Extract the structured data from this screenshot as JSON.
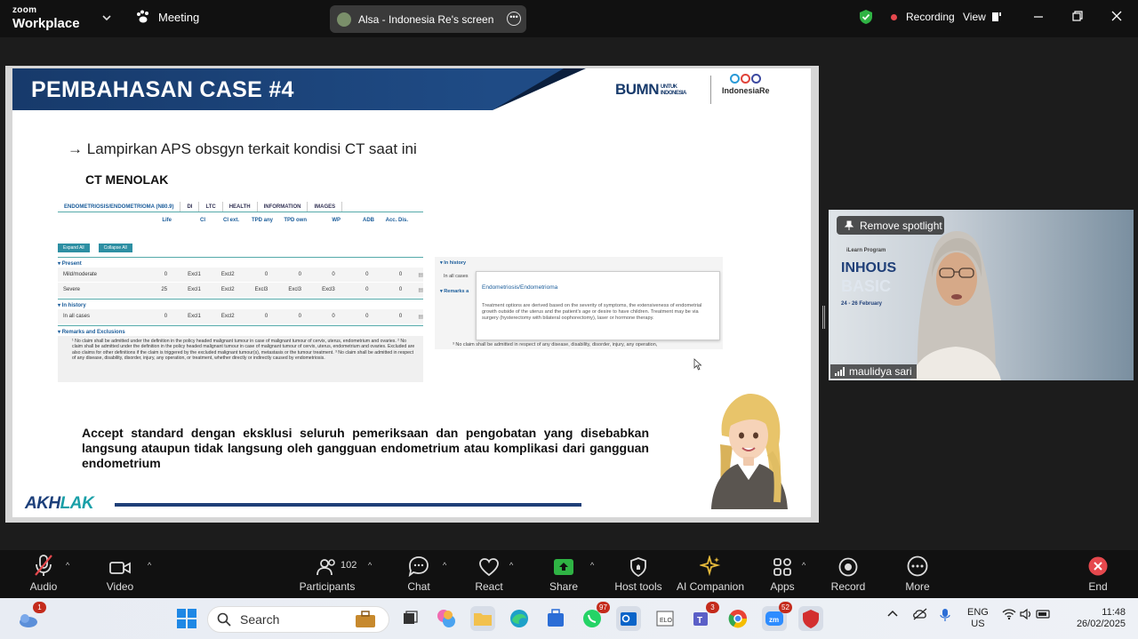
{
  "topbar": {
    "brand_line1": "zoom",
    "brand_line2": "Workplace",
    "meeting_label": "Meeting",
    "share_label": "Alsa - Indonesia Re's screen",
    "recording_label": "Recording",
    "view_label": "View"
  },
  "slide": {
    "title": "PEMBAHASAN CASE #4",
    "logo_bumn": "BUMN",
    "logo_bumn_sub": "UNTUK INDONESIA",
    "logo_ire": "IndonesiaRe",
    "bullet_arrow": "→",
    "bullet": "Lampirkan APS obsgyn terkait kondisi CT saat ini",
    "subhead": "CT MENOLAK",
    "policy_table": {
      "tabs": [
        "ENDOMETRIOSIS/ENDOMETRIOMA (N80.9)",
        "DI",
        "LTC",
        "HEALTH",
        "INFORMATION",
        "IMAGES"
      ],
      "columns": [
        "Life",
        "CI",
        "CI ext.",
        "TPD any",
        "TPD own",
        "WP",
        "ADB",
        "Acc. Dis."
      ],
      "buttons": [
        "Expand All",
        "Collapse All"
      ],
      "section_present": "Present",
      "rows_present": [
        {
          "label": "Mild/moderate",
          "cells": [
            "0",
            "Excl1",
            "Excl2",
            "0",
            "0",
            "0",
            "0",
            "0"
          ]
        },
        {
          "label": "Severe",
          "cells": [
            "25",
            "Excl1",
            "Excl2",
            "Excl3",
            "Excl3",
            "Excl3",
            "0",
            "0"
          ]
        }
      ],
      "section_history": "In history",
      "rows_history": [
        {
          "label": "In all cases",
          "cells": [
            "0",
            "Excl1",
            "Excl2",
            "0",
            "0",
            "0",
            "0",
            "0"
          ]
        }
      ],
      "section_remarks": "Remarks and Exclusions",
      "notes": "¹ No claim shall be admitted under the definition in the policy headed malignant tumour in case of malignant tumour of cervix, uterus, endometrium and ovaries. ² No claim shall be admitted under the definition in the policy headed malignant tumour in case of malignant tumour of cervix, uterus, endometrium and ovaries. Excluded are also claims for other definitions if the claim is triggered by the excluded malignant tumour(s), metastasis or the tumour treatment. ³ No claim shall be admitted in respect of any disease, disability, disorder, injury, any operation, or treatment, whether directly or indirectly caused by endometriosis."
    },
    "panel": {
      "history": "In history",
      "in_all_cases": "In all cases",
      "remarks": "Remarks a",
      "notes_fragment": "³ No claim shall be admitted in respect of any disease, disability, disorder, injury, any operation,"
    },
    "tooltip": {
      "title": "Endometriosis/Endometrioma",
      "body": "Treatment options are derived based on the severity of symptoms, the extensiveness of endometrial growth outside of the uterus and the patient's age or desire to have children. Treatment may be via surgery (hysterectomy with bilateral oophorectomy), laser or hormone therapy."
    },
    "accept_text": "Accept standard dengan eksklusi seluruh pemeriksaan dan pengobatan yang disebabkan langsung ataupun tidak langsung oleh gangguan endometrium atau komplikasi dari gangguan endometrium",
    "footer_logo_a": "AKH",
    "footer_logo_b": "LAK"
  },
  "video": {
    "remove_spotlight": "Remove spotlight",
    "participant_name": "maulidya sari",
    "banner_small": "iLearn Program",
    "banner_line1": "INHOUS",
    "banner_line2": "BASIC",
    "banner_dates": "24 - 26 February"
  },
  "toolbar": {
    "audio": "Audio",
    "video": "Video",
    "participants": "Participants",
    "participants_count": "102",
    "chat": "Chat",
    "react": "React",
    "share": "Share",
    "host_tools": "Host tools",
    "ai_companion": "AI Companion",
    "apps": "Apps",
    "record": "Record",
    "more": "More",
    "end": "End"
  },
  "taskbar": {
    "search_placeholder": "Search",
    "weather_badge": "1",
    "whatsapp_badge": "97",
    "teams_badge": "3",
    "zoom_badge": "52",
    "lang1": "ENG",
    "lang2": "US",
    "time": "11:48",
    "date": "26/02/2025"
  },
  "colors": {
    "slide_header": "#1f4b85",
    "accent_teal": "#1aa0a8",
    "recording_dot": "#e5484d",
    "end_red": "#e5484d",
    "shield_green": "#2fb344"
  }
}
